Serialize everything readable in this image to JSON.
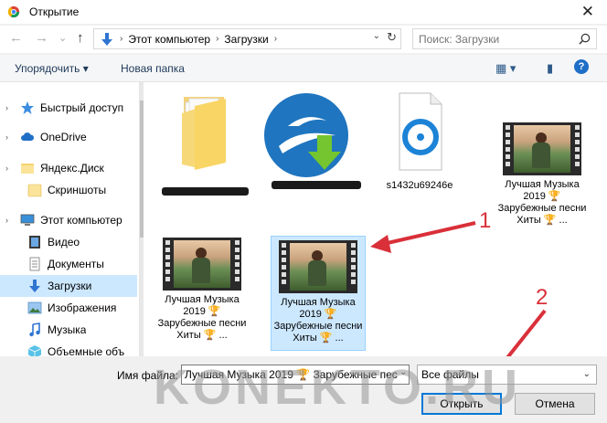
{
  "window": {
    "title": "Открытие",
    "close_glyph": "✕"
  },
  "nav_buttons": {
    "back": "←",
    "forward": "→",
    "recent": "⌄",
    "up": "↑"
  },
  "address": {
    "crumbs": [
      "Этот компьютер",
      "Загрузки"
    ],
    "separator": "›",
    "dropdown": "⌄",
    "refresh": "↻"
  },
  "search": {
    "placeholder": "Поиск: Загрузки",
    "icon": "search-icon"
  },
  "toolbar": {
    "organize": "Упорядочить ▾",
    "new_folder": "Новая папка",
    "view": "▦ ▾",
    "preview": "▮",
    "help": "?"
  },
  "sidebar": {
    "items": [
      {
        "label": "Быстрый доступ",
        "icon": "star-icon"
      },
      {
        "label": "OneDrive",
        "icon": "cloud-icon"
      },
      {
        "label": "Яндекс.Диск",
        "icon": "yandex-disk-icon"
      },
      {
        "label": "Скриншоты",
        "icon": "folder-icon"
      },
      {
        "label": "Этот компьютер",
        "icon": "computer-icon"
      },
      {
        "label": "Видео",
        "icon": "video-folder-icon"
      },
      {
        "label": "Документы",
        "icon": "documents-folder-icon"
      },
      {
        "label": "Загрузки",
        "icon": "downloads-arrow-icon"
      },
      {
        "label": "Изображения",
        "icon": "pictures-folder-icon"
      },
      {
        "label": "Музыка",
        "icon": "music-note-icon"
      },
      {
        "label": "Объемные объ",
        "icon": "3d-objects-icon"
      }
    ],
    "selected_index": 7
  },
  "files": [
    {
      "name": "",
      "type": "folder"
    },
    {
      "name": "",
      "type": "installer"
    },
    {
      "name": "s1432u69246e",
      "type": "media-file"
    },
    {
      "name": "Лучшая Музыка 2019 🏆 Зарубежные песни Хиты 🏆 ...",
      "type": "video"
    },
    {
      "name": "Лучшая Музыка 2019 🏆 Зарубежные песни Хиты 🏆 ...",
      "type": "video"
    },
    {
      "name": "Лучшая Музыка 2019 🏆 Зарубежные песни Хиты 🏆 ...",
      "type": "video",
      "selected": true
    }
  ],
  "bottom": {
    "filename_label": "Имя файла:",
    "filename_value": "Лучшая Музыка 2019 🏆 Зарубежные пес",
    "filename_dropdown": "⌄",
    "filter": "Все файлы",
    "filter_dropdown": "⌄",
    "open": "Открыть",
    "cancel": "Отмена"
  },
  "annotations": {
    "one": "1",
    "two": "2",
    "color": "#d9303a"
  },
  "watermark": "KONEKTO.RU",
  "colors": {
    "selection": "#cce8ff",
    "accent": "#0078d7"
  }
}
